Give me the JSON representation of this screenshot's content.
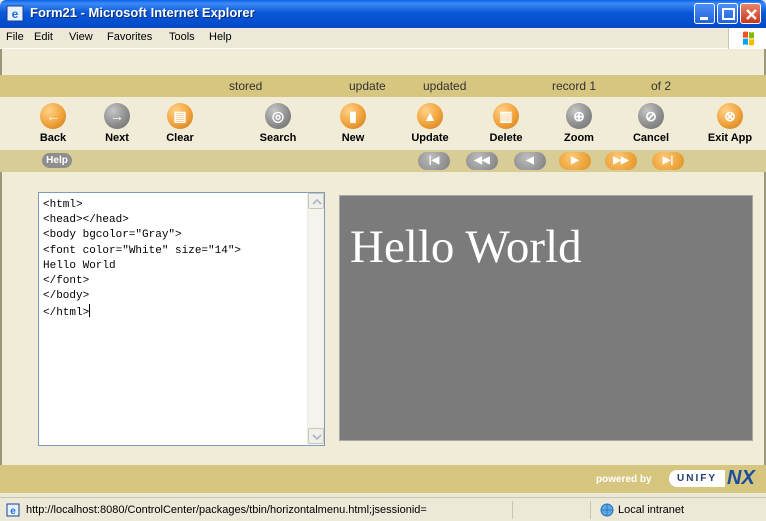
{
  "window": {
    "title": "Form21 - Microsoft Internet Explorer"
  },
  "menu": {
    "items": [
      {
        "label": "File"
      },
      {
        "label": "Edit"
      },
      {
        "label": "View"
      },
      {
        "label": "Favorites"
      },
      {
        "label": "Tools"
      },
      {
        "label": "Help"
      }
    ]
  },
  "status_row": {
    "state1": "stored",
    "state2": "update",
    "state3": "updated",
    "record": "record 1",
    "of": "of 2"
  },
  "toolbar": {
    "buttons": [
      {
        "label": "Back",
        "icon": "arrow-left-icon"
      },
      {
        "label": "Next",
        "icon": "arrow-right-icon"
      },
      {
        "label": "Clear",
        "icon": "clear-icon"
      },
      {
        "label": "Search",
        "icon": "search-icon"
      },
      {
        "label": "New",
        "icon": "new-icon"
      },
      {
        "label": "Update",
        "icon": "update-icon"
      },
      {
        "label": "Delete",
        "icon": "delete-icon"
      },
      {
        "label": "Zoom",
        "icon": "zoom-icon"
      },
      {
        "label": "Cancel",
        "icon": "cancel-icon"
      },
      {
        "label": "Exit App",
        "icon": "exit-icon"
      }
    ]
  },
  "navbar": {
    "help_label": "Help"
  },
  "editor": {
    "content": "<html>\n<head></head>\n<body bgcolor=\"Gray\">\n<font color=\"White\" size=\"14\">\nHello World\n</font>\n</body>\n</html>"
  },
  "preview": {
    "text": "Hello World"
  },
  "footer": {
    "powered_by": "powered by",
    "brand": "UNIFY",
    "brand_suffix": "NX"
  },
  "statusbar": {
    "url": "http://localhost:8080/ControlCenter/packages/tbin/horizontalmenu.html;jsessionid=",
    "zone": "Local intranet"
  },
  "colors": {
    "titlebar": "#0a58d8",
    "band": "#d6c680",
    "preview_bg": "#7b7b7b",
    "accent_orange": "#f0a23a"
  }
}
